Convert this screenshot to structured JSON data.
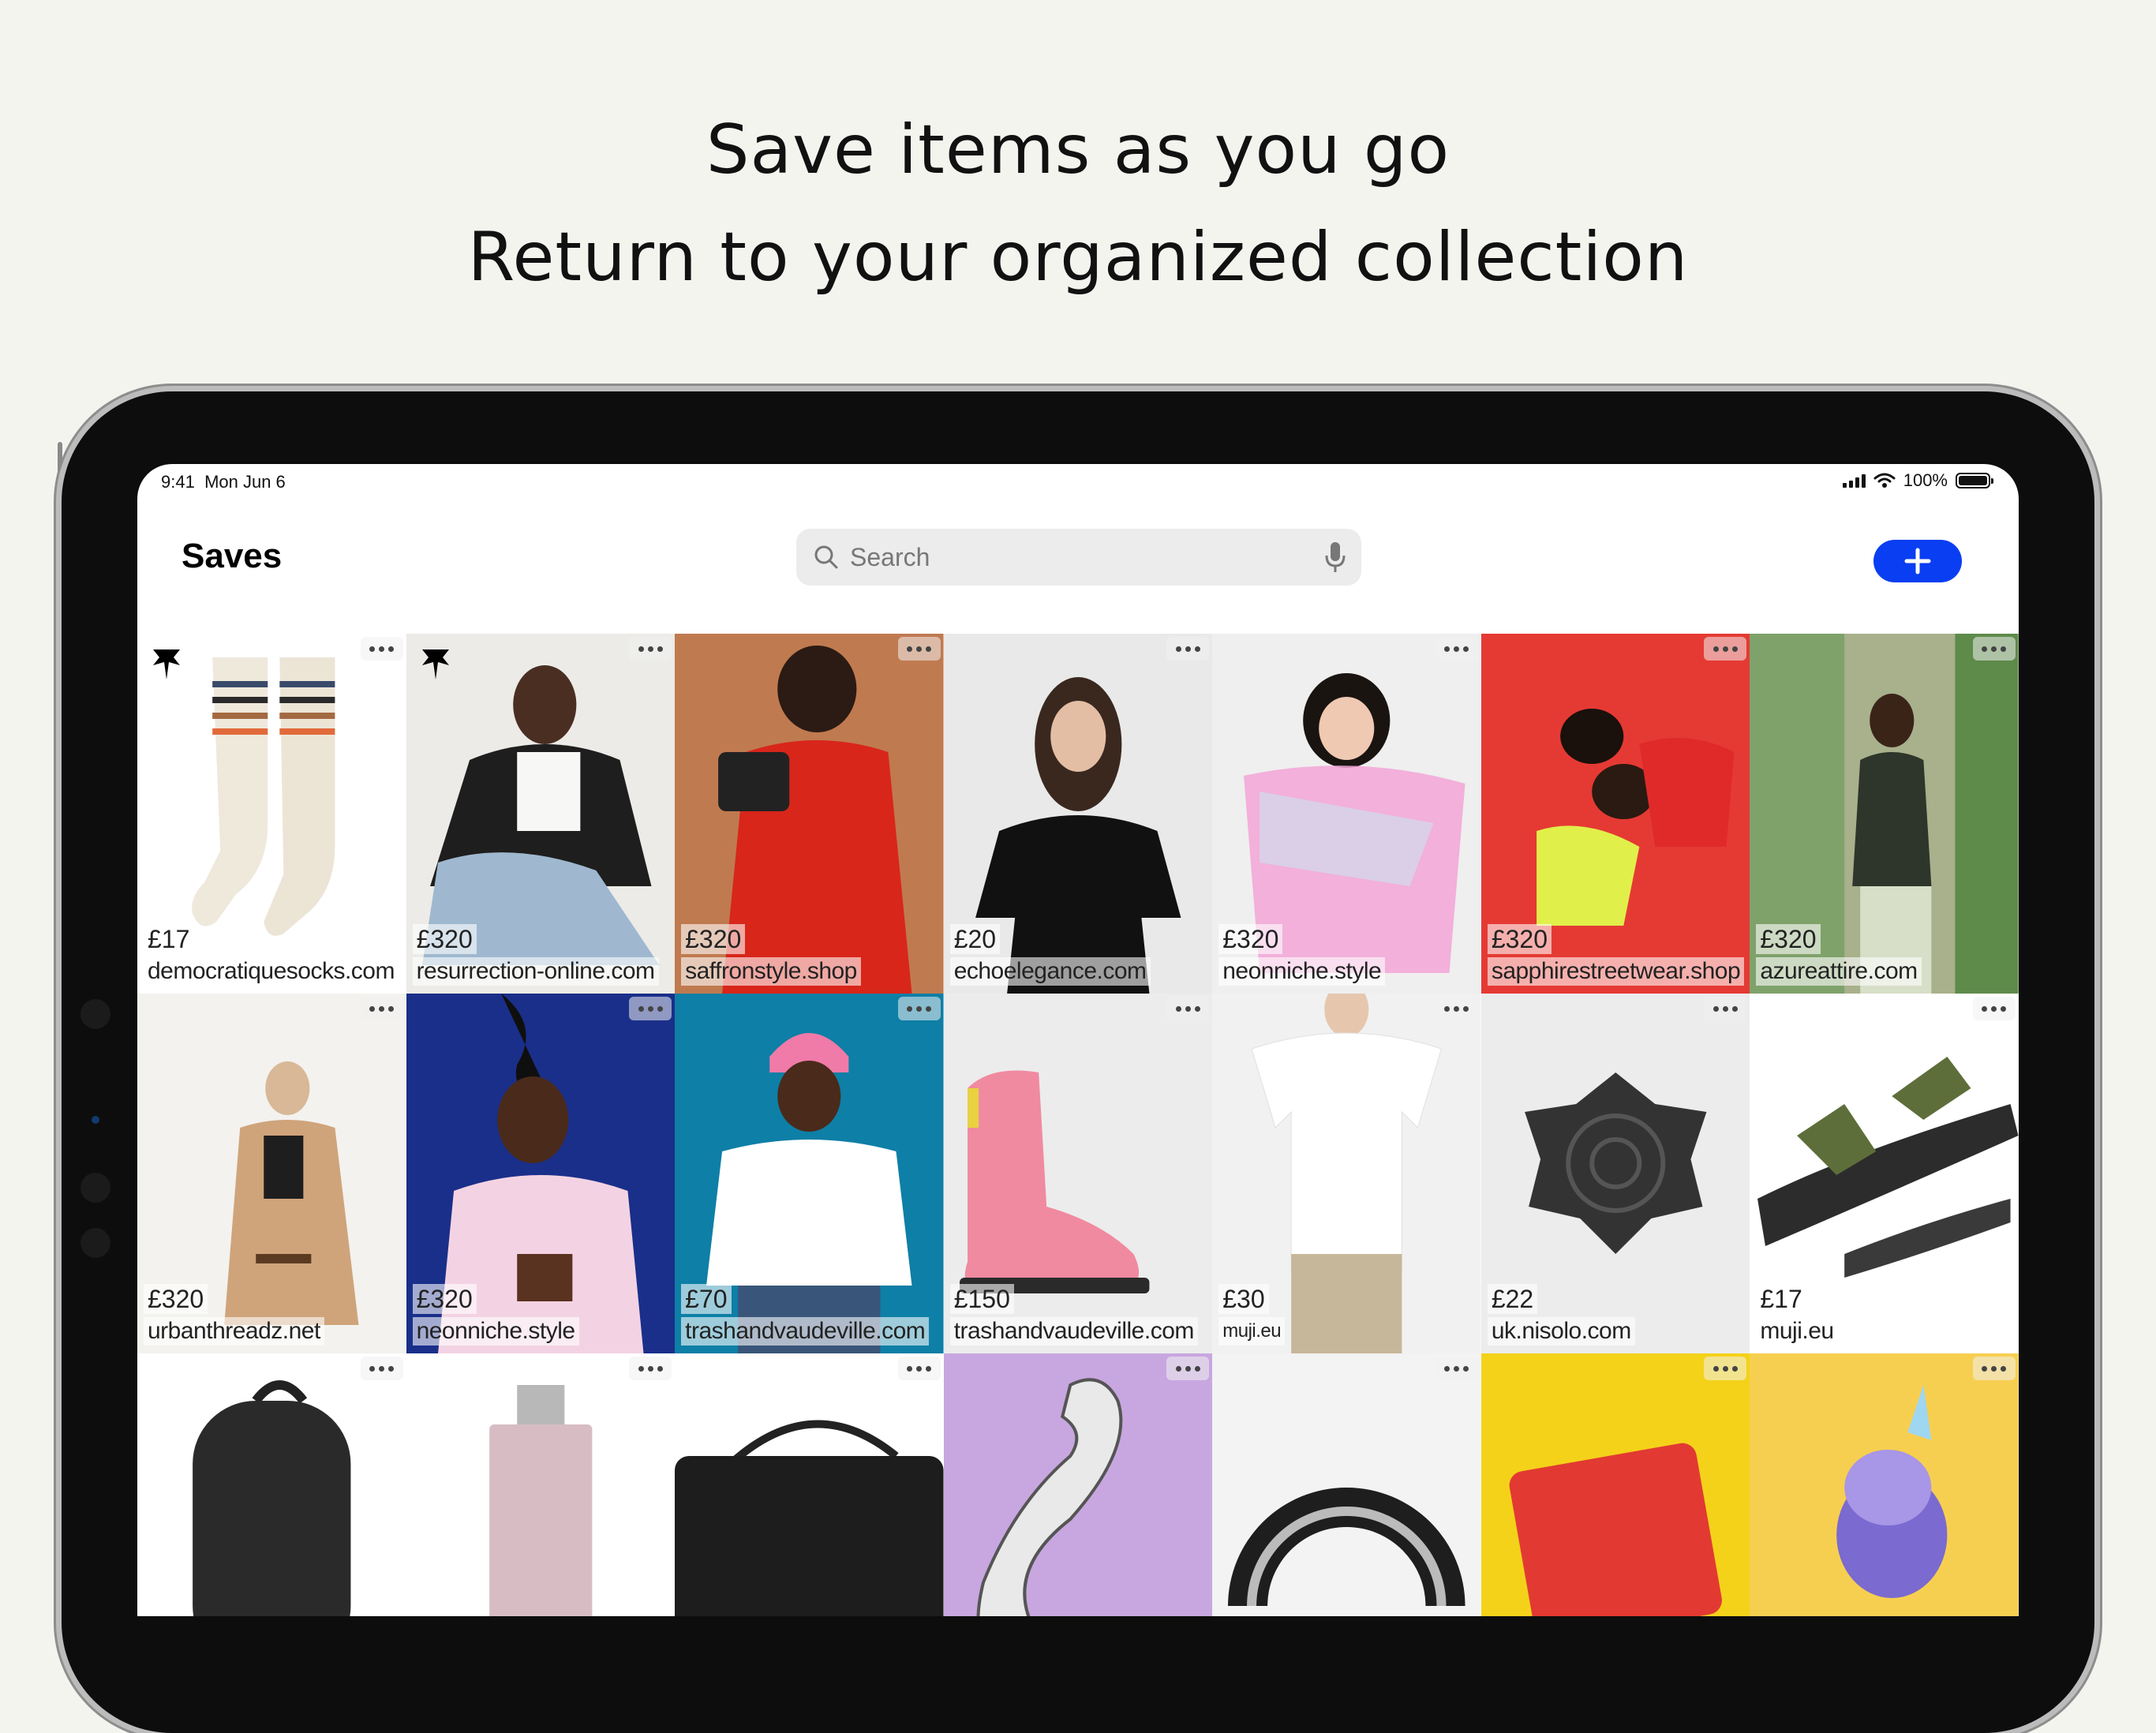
{
  "headline": {
    "line1": "Save items as you go",
    "line2": "Return to your organized collection"
  },
  "status_bar": {
    "time": "9:41",
    "date": "Mon Jun 6",
    "battery": "100%"
  },
  "header": {
    "title": "Saves",
    "search_placeholder": "Search",
    "add_button_icon": "plus-icon",
    "accent_color": "#0a3ef2"
  },
  "items": [
    {
      "price": "£17",
      "domain": "democratiquesocks.com",
      "pinned": true,
      "icon": "socks-photo"
    },
    {
      "price": "£320",
      "domain": "resurrection-online.com",
      "pinned": true,
      "icon": "leather-jacket-photo"
    },
    {
      "price": "£320",
      "domain": "saffronstyle.shop",
      "pinned": false,
      "icon": "red-dress-handbag-photo"
    },
    {
      "price": "£20",
      "domain": "echoelegance.com",
      "pinned": false,
      "icon": "black-tshirt-photo"
    },
    {
      "price": "£320",
      "domain": "neonniche.style",
      "pinned": false,
      "icon": "holographic-top-photo"
    },
    {
      "price": "£320",
      "domain": "sapphirestreetwear.shop",
      "pinned": false,
      "icon": "two-models-red-photo"
    },
    {
      "price": "£320",
      "domain": "azureattire.com",
      "pinned": false,
      "icon": "man-green-vest-photo"
    },
    {
      "price": "£320",
      "domain": "urbanthreadz.net",
      "pinned": false,
      "icon": "beige-coat-photo"
    },
    {
      "price": "£320",
      "domain": "neonniche.style",
      "pinned": false,
      "icon": "striped-shirt-photo"
    },
    {
      "price": "£70",
      "domain": "trashandvaudeville.com",
      "pinned": false,
      "icon": "white-tee-pink-beanie-photo"
    },
    {
      "price": "£150",
      "domain": "trashandvaudeville.com",
      "pinned": false,
      "icon": "pink-boot-photo"
    },
    {
      "price": "£30",
      "domain": "muji.eu",
      "pinned": false,
      "icon": "white-tee-photo"
    },
    {
      "price": "£22",
      "domain": "uk.nisolo.com",
      "pinned": false,
      "icon": "spiderweb-tray-photo"
    },
    {
      "price": "£17",
      "domain": "muji.eu",
      "pinned": false,
      "icon": "green-sandal-photo"
    },
    {
      "price": "",
      "domain": "",
      "pinned": false,
      "icon": "black-backpack-photo"
    },
    {
      "price": "",
      "domain": "",
      "pinned": false,
      "icon": "pink-bottle-photo"
    },
    {
      "price": "",
      "domain": "",
      "pinned": false,
      "icon": "studded-bag-photo"
    },
    {
      "price": "",
      "domain": "",
      "pinned": false,
      "icon": "cat-pin-photo"
    },
    {
      "price": "",
      "domain": "",
      "pinned": false,
      "icon": "rainbow-pin-photo"
    },
    {
      "price": "",
      "domain": "",
      "pinned": false,
      "icon": "empowered-women-pin-photo"
    },
    {
      "price": "",
      "domain": "",
      "pinned": false,
      "icon": "unicorn-cat-pin-photo"
    }
  ]
}
